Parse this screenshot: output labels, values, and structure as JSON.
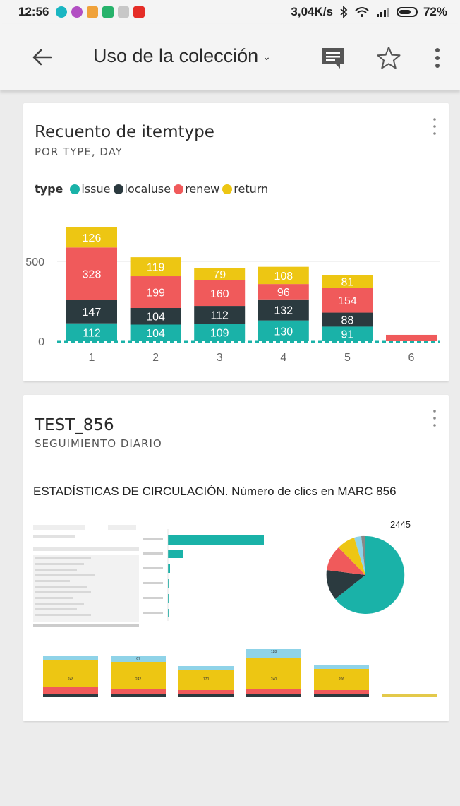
{
  "status_bar": {
    "time": "12:56",
    "network_speed": "3,04K/s",
    "battery": "72%",
    "notification_icons": [
      "status-app-icon-teal",
      "status-app-icon-purple",
      "status-app-icon-orange",
      "status-app-icon-green",
      "status-app-icon-calendar",
      "status-app-icon-youtube"
    ]
  },
  "app_bar": {
    "title": "Uso de la colección",
    "title_chevron": "⌄"
  },
  "card1": {
    "title": "Recuento de itemtype",
    "subtitle": "POR TYPE, DAY",
    "chart_data": {
      "type": "bar",
      "stacked": true,
      "legend_title": "type",
      "legend_position": "top-left",
      "categories": [
        "1",
        "2",
        "3",
        "4",
        "5",
        "6"
      ],
      "series": [
        {
          "name": "issue",
          "color": "#1ab2a8",
          "values": [
            112,
            104,
            109,
            130,
            91,
            0
          ],
          "labels": [
            "112",
            "104",
            "109",
            "130",
            "91",
            ""
          ]
        },
        {
          "name": "localuse",
          "color": "#2b3a3f",
          "values": [
            147,
            104,
            112,
            132,
            88,
            0
          ],
          "labels": [
            "147",
            "104",
            "112",
            "132",
            "88",
            ""
          ]
        },
        {
          "name": "renew",
          "color": "#f05a5b",
          "values": [
            328,
            199,
            160,
            96,
            154,
            40
          ],
          "labels": [
            "328",
            "199",
            "160",
            "96",
            "154",
            ""
          ]
        },
        {
          "name": "return",
          "color": "#edc613",
          "values": [
            126,
            119,
            79,
            108,
            81,
            0
          ],
          "labels": [
            "126",
            "119",
            "79",
            "108",
            "81",
            ""
          ]
        }
      ],
      "yticks": [
        0,
        500
      ],
      "ylim": [
        0,
        760
      ],
      "grid": true
    }
  },
  "card2": {
    "title": "TEST_856",
    "subtitle": "SEGUIMIENTO DIARIO",
    "thumbnail_title": "ESTADÍSTICAS DE CIRCULACIÓN. Número de clics en MARC 856",
    "pie_total": "2445",
    "thumbnail_stacked_values": [
      "248",
      "242",
      "170",
      "240",
      "206",
      ""
    ],
    "thumbnail_top_values": [
      "",
      "67",
      "",
      "128",
      "",
      ""
    ]
  },
  "colors": {
    "issue": "#1ab2a8",
    "localuse": "#2b3a3f",
    "renew": "#f05a5b",
    "return": "#edc613",
    "light_blue": "#8fd3e8"
  }
}
